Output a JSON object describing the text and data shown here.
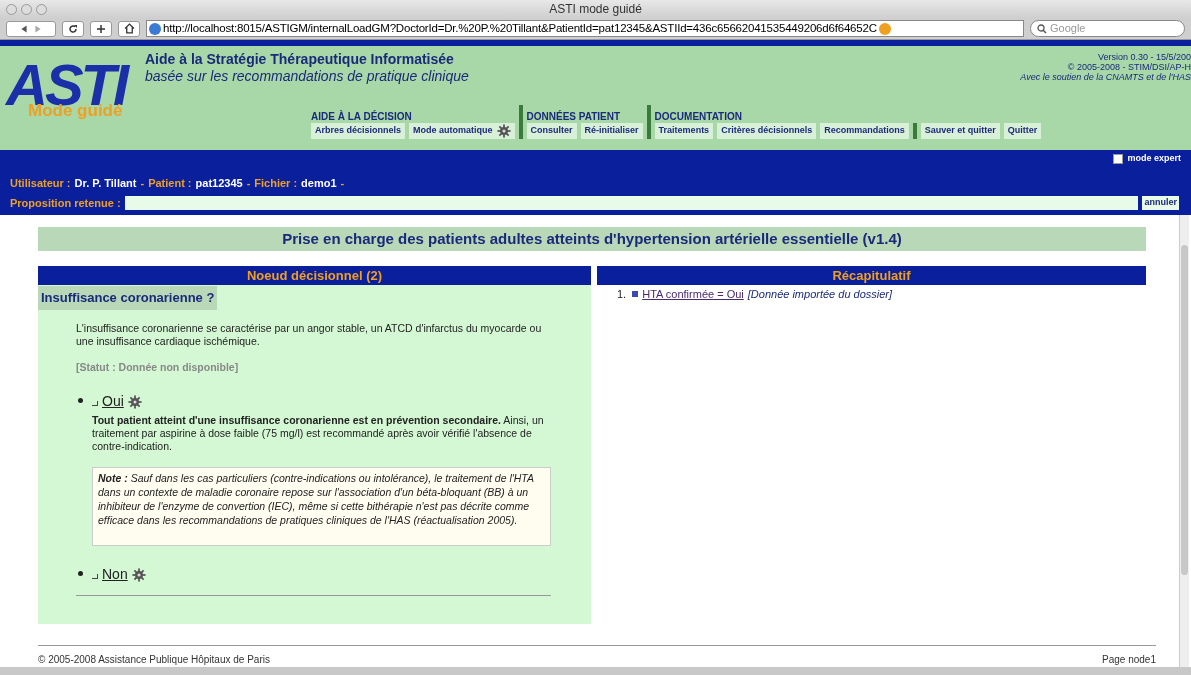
{
  "window": {
    "title": "ASTI mode guidé"
  },
  "toolbar": {
    "url": "http://localhost:8015/ASTIGM/internalLoadGM?DoctorId=Dr.%20P.%20Tillant&PatientId=pat12345&ASTIId=436c65662041535449206d6f64652C",
    "search_placeholder": "Google"
  },
  "header": {
    "logo": "ASTI",
    "logo_sub": "Mode guidé",
    "title": "Aide à la Stratégie Thérapeutique Informatisée",
    "subtitle": "basée sur les recommandations de pratique clinique",
    "version": "Version 0.30 - 15/5/200",
    "copyright": "© 2005-2008 - STIM/DSI/AP-H",
    "support": "Avec le soutien de la CNAMTS et de l'HAS",
    "menus": [
      {
        "title": "AIDE À LA DÉCISION",
        "items": [
          {
            "label": "Arbres décisionnels",
            "gear": false
          },
          {
            "label": "Mode automatique",
            "gear": true
          }
        ]
      },
      {
        "title": "DONNÉES PATIENT",
        "items": [
          {
            "label": "Consulter",
            "gear": false
          },
          {
            "label": "Ré-initialiser",
            "gear": false
          }
        ]
      },
      {
        "title": "DOCUMENTATION",
        "items": [
          {
            "label": "Traitements",
            "gear": false
          },
          {
            "label": "Critères décisionnels",
            "gear": false
          },
          {
            "label": "Recommandations",
            "gear": false
          }
        ]
      },
      {
        "items": [
          {
            "label": "Sauver et quitter",
            "gear": false
          },
          {
            "label": "Quitter",
            "gear": false
          }
        ]
      }
    ]
  },
  "mode_expert": {
    "label": "mode expert",
    "checked": false
  },
  "session": [
    {
      "label": "Utilisateur :",
      "value": "Dr. P. Tillant"
    },
    {
      "label": "Patient :",
      "value": "pat12345"
    },
    {
      "label": "Fichier :",
      "value": "demo1"
    }
  ],
  "session_sep": "-",
  "proposition": {
    "label": "Proposition retenue :",
    "button": "annuler"
  },
  "page_title": "Prise en charge des patients adultes atteints d'hypertension artérielle essentielle (v1.4)",
  "node": {
    "heading": "Noeud décisionnel (2)",
    "question": "Insuffisance coronarienne ?",
    "description": "L'insuffisance coronarienne se caractérise par un angor stable, un ATCD d'infarctus du myocarde ou une insuffisance cardiaque ischémique.",
    "status": "[Statut : Donnée non disponible]",
    "options": [
      {
        "label": "Oui",
        "text": "**Tout patient atteint d'une insuffisance coronarienne est en prévention secondaire.** Ainsi, un traitement par aspirine à dose faible (75 mg/l) est recommandé après avoir vérifié l'absence de contre-indication.",
        "note": "**Note :** Sauf dans les cas particuliers (contre-indications ou intolérance), le traitement de l'HTA dans un contexte de maladie coronaire repose sur l'association d'un béta-bloquant (BB) à un inhibiteur de l'enzyme de convertion (IEC), même si cette bithérapie n'est pas décrite comme efficace dans les recommandations de pratiques cliniques de l'HAS (réactualisation 2005)."
      },
      {
        "label": "Non"
      }
    ]
  },
  "summary": {
    "heading": "Récapitulatif",
    "items": [
      {
        "number": "1.",
        "link": "HTA confirmée = Oui",
        "note": "[Donnée importée du dossier]"
      }
    ]
  },
  "footer": {
    "left": "© 2005-2008 Assistance Publique Hôpitaux de Paris",
    "right": "Page node1"
  }
}
